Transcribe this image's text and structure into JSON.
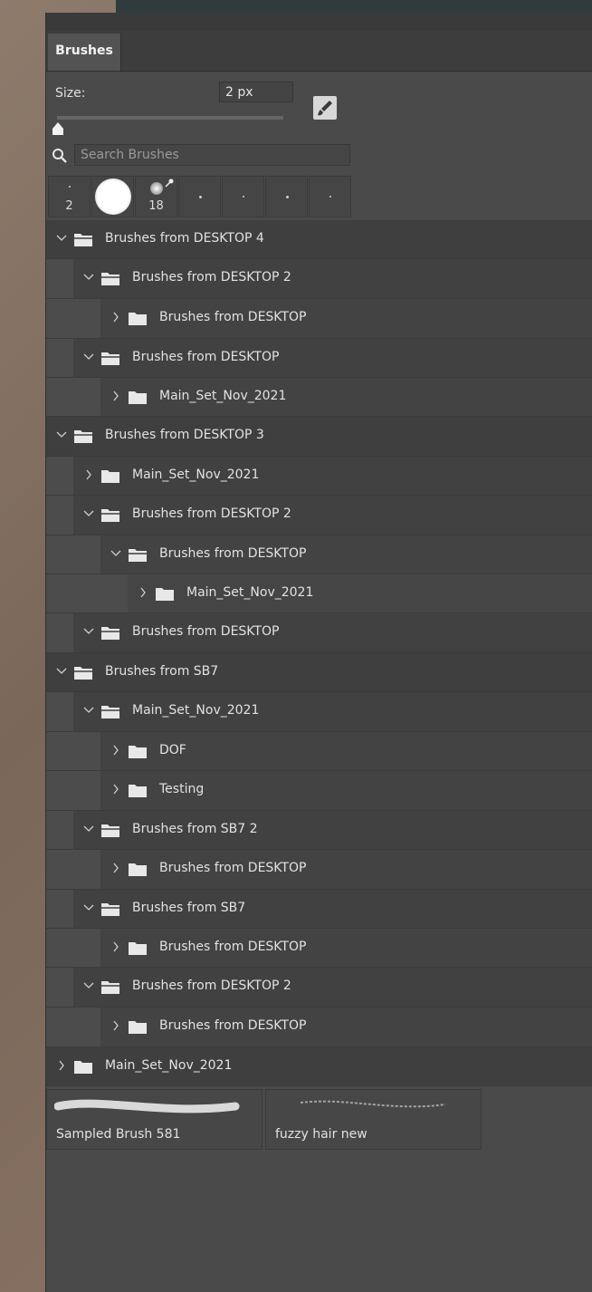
{
  "panel": {
    "tab_label": "Brushes",
    "size_label": "Size:",
    "size_value": "2 px",
    "slider_position": 0.0,
    "search_placeholder": "Search Brushes"
  },
  "presets": [
    {
      "num": "2",
      "icon": "tiny-dot"
    },
    {
      "num": "",
      "icon": "large-soft-round"
    },
    {
      "num": "18",
      "icon": "soft-round-with-pressure"
    },
    {
      "num": "",
      "icon": "small-dot"
    },
    {
      "num": "",
      "icon": "tiny-dot"
    },
    {
      "num": "",
      "icon": "small-dot"
    },
    {
      "num": "",
      "icon": "tiny-dot"
    }
  ],
  "tree": [
    {
      "label": "Brushes from DESKTOP 4",
      "level": 0,
      "expanded": true
    },
    {
      "label": "Brushes from DESKTOP 2",
      "level": 1,
      "expanded": true
    },
    {
      "label": "Brushes from DESKTOP",
      "level": 2,
      "expanded": false
    },
    {
      "label": "Brushes from DESKTOP",
      "level": 1,
      "expanded": true
    },
    {
      "label": "Main_Set_Nov_2021",
      "level": 2,
      "expanded": false
    },
    {
      "label": "Brushes from DESKTOP 3",
      "level": 0,
      "expanded": true
    },
    {
      "label": "Main_Set_Nov_2021",
      "level": 1,
      "expanded": false
    },
    {
      "label": "Brushes from DESKTOP 2",
      "level": 1,
      "expanded": true
    },
    {
      "label": "Brushes from DESKTOP",
      "level": 2,
      "expanded": true
    },
    {
      "label": "Main_Set_Nov_2021",
      "level": 3,
      "expanded": false
    },
    {
      "label": "Brushes from DESKTOP",
      "level": 1,
      "expanded": true
    },
    {
      "label": "Brushes from SB7",
      "level": 0,
      "expanded": true
    },
    {
      "label": "Main_Set_Nov_2021",
      "level": 1,
      "expanded": true
    },
    {
      "label": "DOF",
      "level": 2,
      "expanded": false
    },
    {
      "label": "Testing",
      "level": 2,
      "expanded": false
    },
    {
      "label": "Brushes from SB7 2",
      "level": 1,
      "expanded": true
    },
    {
      "label": "Brushes from DESKTOP",
      "level": 2,
      "expanded": false
    },
    {
      "label": "Brushes from SB7",
      "level": 1,
      "expanded": true
    },
    {
      "label": "Brushes from DESKTOP",
      "level": 2,
      "expanded": false
    },
    {
      "label": "Brushes from DESKTOP 2",
      "level": 1,
      "expanded": true
    },
    {
      "label": "Brushes from DESKTOP",
      "level": 2,
      "expanded": false
    },
    {
      "label": "Main_Set_Nov_2021",
      "level": 0,
      "expanded": false
    }
  ],
  "brush_thumbs": [
    {
      "label": "Sampled Brush 581"
    },
    {
      "label": "fuzzy hair new"
    }
  ]
}
